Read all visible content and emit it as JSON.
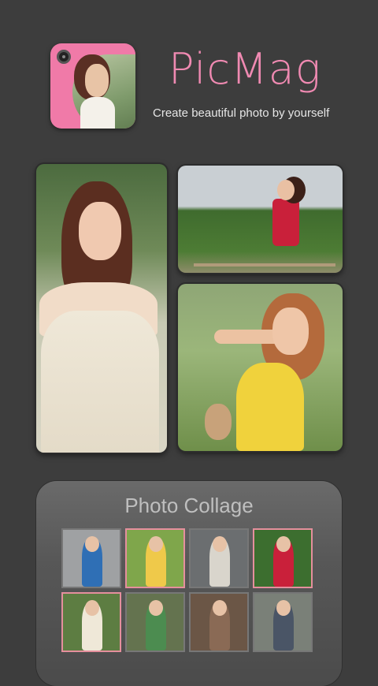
{
  "header": {
    "app_name": "PicMag",
    "tagline": "Create beautiful photo by yourself",
    "app_icon": "camera-portrait-icon"
  },
  "colors": {
    "background": "#3d3d3d",
    "brand_pink": "#f08ab2",
    "selected_border": "#e58f9d"
  },
  "collage_panel": {
    "title": "Photo Collage",
    "thumbnails": [
      {
        "bg": "#9fa1a3",
        "figure": "#2f6fb5",
        "selected": false
      },
      {
        "bg": "#7fa64b",
        "figure": "#efc94a",
        "selected": true
      },
      {
        "bg": "#6b6e70",
        "figure": "#d9d5cc",
        "selected": false
      },
      {
        "bg": "#3c6e2f",
        "figure": "#c9203a",
        "selected": true
      },
      {
        "bg": "#5d7d42",
        "figure": "#efe8d8",
        "selected": true
      },
      {
        "bg": "#64734f",
        "figure": "#4c8c50",
        "selected": false
      },
      {
        "bg": "#6b5646",
        "figure": "#8a6a55",
        "selected": false
      },
      {
        "bg": "#7a8078",
        "figure": "#4a5566",
        "selected": false
      }
    ]
  }
}
